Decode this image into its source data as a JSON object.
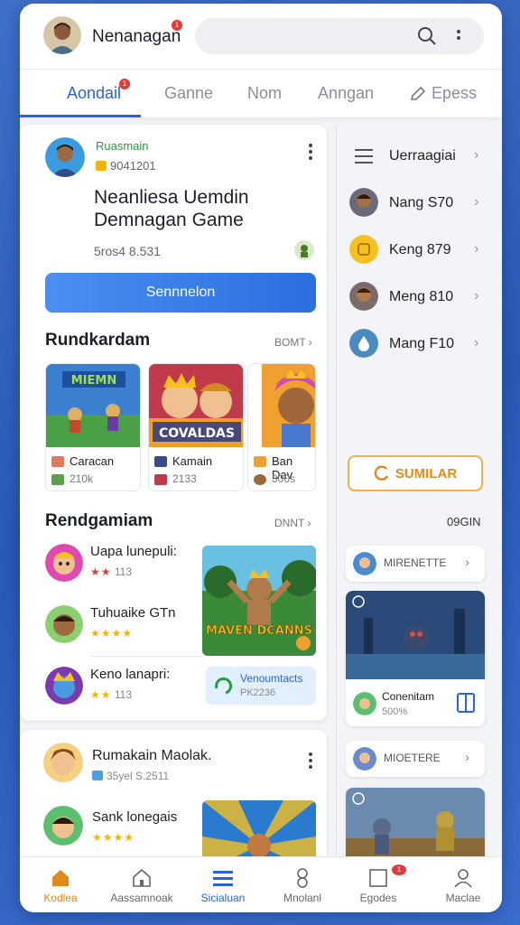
{
  "header": {
    "app_title": "Nenanagan",
    "badge": "1",
    "search_icon": "search-icon",
    "more_icon": "more-vertical-icon"
  },
  "tabs": [
    {
      "label": "Aondail",
      "active": true,
      "badge": "1"
    },
    {
      "label": "Ganne"
    },
    {
      "label": "Nom"
    },
    {
      "label": "Anngan"
    },
    {
      "label": "Epess",
      "icon": "pencil-icon"
    }
  ],
  "profile": {
    "name": "Ruasmain",
    "id": "9041201",
    "headline": "Neanliesa Uemdin Demnagan Game",
    "score": "5ros4 8.531",
    "button_label": "Sennnelon"
  },
  "recommended": {
    "title": "Rundkardam",
    "more": "BOMT",
    "games": [
      {
        "name": "Caracan",
        "count": "210k",
        "art_text": "MIEMN"
      },
      {
        "name": "Kamain",
        "count": "2133",
        "art_text": "COVALDAS"
      },
      {
        "name": "Ban Dav",
        "count": "300s",
        "art_text": ""
      }
    ]
  },
  "ranking": {
    "title": "Rendgamiam",
    "more": "DNNT",
    "items": [
      {
        "name": "Uapa lunepuli:",
        "stars": "★★",
        "meta": "113",
        "star_color": "red"
      },
      {
        "name": "Tuhuaike GTn",
        "stars": "★★★★",
        "meta": ""
      },
      {
        "name": "Keno lanapri:",
        "stars": "★★",
        "meta": "113"
      }
    ],
    "feature_text": "MAVEN DCANNS",
    "promo": {
      "title": "Venoumtacts",
      "sub": "PK2236"
    }
  },
  "sub_card": {
    "title": "Rumakain Maolak.",
    "meta": "35yel S.2511",
    "item_name": "Sank lonegais",
    "item_stars": "★★★★"
  },
  "side_menu": [
    {
      "label": "Uerraagiai",
      "icon": "menu-icon"
    },
    {
      "label": "Nang S70",
      "icon": "avatar"
    },
    {
      "label": "Keng 879",
      "icon": "coin-icon"
    },
    {
      "label": "Meng 810",
      "icon": "avatar"
    },
    {
      "label": "Mang F10",
      "icon": "drop-icon"
    }
  ],
  "side": {
    "similar_button": "SUMILAR",
    "login_label": "09GIN",
    "card1_label": "MIRENETTE",
    "card2_name": "Conenitam",
    "card2_meta": "500%",
    "card3_label": "MIOETERE"
  },
  "bottom_nav": [
    {
      "label": "Kodlea",
      "icon": "home-icon",
      "state": "active"
    },
    {
      "label": "Aassamnoak",
      "icon": "house-outline-icon"
    },
    {
      "label": "Sicialuan",
      "icon": "list-icon",
      "state": "sel"
    },
    {
      "label": "Mnolanl",
      "icon": "figure-icon"
    },
    {
      "label": "Egodes",
      "icon": "square-icon",
      "badge": "1"
    },
    {
      "label": "Maclae",
      "icon": "user-icon"
    }
  ],
  "colors": {
    "accent": "#2a64d8",
    "orange": "#e08a1a",
    "green": "#2a9a3f"
  }
}
